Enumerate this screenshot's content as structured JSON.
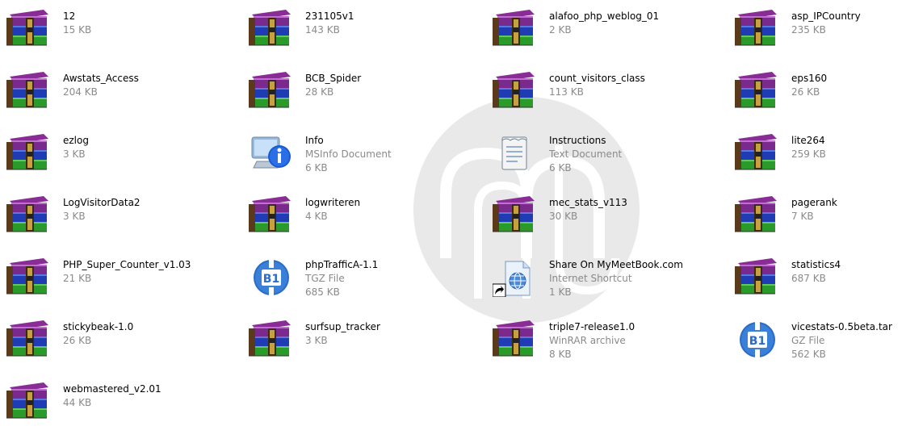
{
  "items": [
    {
      "name": "12",
      "type": "",
      "size": "15 KB",
      "icon": "winrar-archive-icon"
    },
    {
      "name": "231105v1",
      "type": "",
      "size": "143 KB",
      "icon": "winrar-archive-icon"
    },
    {
      "name": "alafoo_php_weblog_01",
      "type": "",
      "size": "2 KB",
      "icon": "winrar-archive-icon"
    },
    {
      "name": "asp_IPCountry",
      "type": "",
      "size": "235 KB",
      "icon": "winrar-archive-icon"
    },
    {
      "name": "Awstats_Access",
      "type": "",
      "size": "204 KB",
      "icon": "winrar-archive-icon"
    },
    {
      "name": "BCB_Spider",
      "type": "",
      "size": "28 KB",
      "icon": "winrar-archive-icon"
    },
    {
      "name": "count_visitors_class",
      "type": "",
      "size": "113 KB",
      "icon": "winrar-archive-icon"
    },
    {
      "name": "eps160",
      "type": "",
      "size": "26 KB",
      "icon": "winrar-archive-icon"
    },
    {
      "name": "ezlog",
      "type": "",
      "size": "3 KB",
      "icon": "winrar-archive-icon"
    },
    {
      "name": "Info",
      "type": "MSInfo Document",
      "size": "6 KB",
      "icon": "msinfo-icon"
    },
    {
      "name": "Instructions",
      "type": "Text Document",
      "size": "6 KB",
      "icon": "text-document-icon"
    },
    {
      "name": "lite264",
      "type": "",
      "size": "259 KB",
      "icon": "winrar-archive-icon"
    },
    {
      "name": "LogVisitorData2",
      "type": "",
      "size": "3 KB",
      "icon": "winrar-archive-icon"
    },
    {
      "name": "logwriteren",
      "type": "",
      "size": "4 KB",
      "icon": "winrar-archive-icon"
    },
    {
      "name": "mec_stats_v113",
      "type": "",
      "size": "30 KB",
      "icon": "winrar-archive-icon"
    },
    {
      "name": "pagerank",
      "type": "",
      "size": "7 KB",
      "icon": "winrar-archive-icon"
    },
    {
      "name": "PHP_Super_Counter_v1.03",
      "type": "",
      "size": "21 KB",
      "icon": "winrar-archive-icon"
    },
    {
      "name": "phpTrafficA-1.1",
      "type": "TGZ File",
      "size": "685 KB",
      "icon": "b1-archive-icon"
    },
    {
      "name": "Share On MyMeetBook.com",
      "type": "Internet Shortcut",
      "size": "1 KB",
      "icon": "internet-shortcut-icon"
    },
    {
      "name": "statistics4",
      "type": "",
      "size": "687 KB",
      "icon": "winrar-archive-icon"
    },
    {
      "name": "stickybeak-1.0",
      "type": "",
      "size": "26 KB",
      "icon": "winrar-archive-icon"
    },
    {
      "name": "surfsup_tracker",
      "type": "",
      "size": "3 KB",
      "icon": "winrar-archive-icon"
    },
    {
      "name": "triple7-release1.0",
      "type": "WinRAR archive",
      "size": "8 KB",
      "icon": "winrar-archive-icon"
    },
    {
      "name": "vicestats-0.5beta.tar",
      "type": "GZ File",
      "size": "562 KB",
      "icon": "b1-archive-icon"
    },
    {
      "name": "webmastered_v2.01",
      "type": "",
      "size": "44 KB",
      "icon": "winrar-archive-icon"
    }
  ],
  "colors": {
    "text": "#000000",
    "subtext": "#8a8a8a",
    "rar_purple": "#7a2a8c",
    "rar_blue": "#1f3cb4",
    "rar_green": "#2a9a2a",
    "b1_blue": "#2a6cc8"
  }
}
